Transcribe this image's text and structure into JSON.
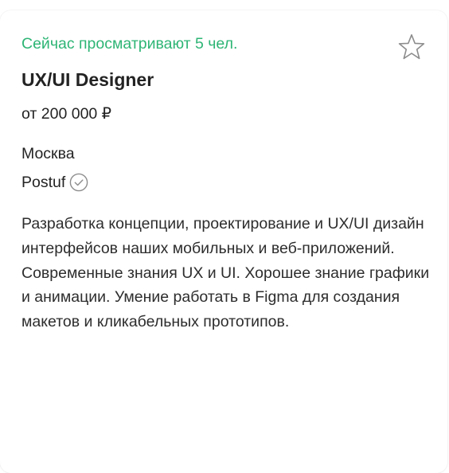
{
  "vacancy": {
    "viewers_text": "Сейчас просматривают 5 чел.",
    "title": "UX/UI Designer",
    "salary": "от 200 000 ₽",
    "city": "Москва",
    "company": "Postuf",
    "description": [
      "Разработка концепции, проектирование и UX/UI дизайн интерфейсов наших мобильных и веб-приложений.",
      "Современные знания UX и UI. Хорошее знание графики и анимации. Умение работать в Figma для создания макетов и кликабельных прототипов."
    ]
  },
  "icons": {
    "favorite": "star-outline-icon",
    "verified": "check-circle-icon"
  },
  "colors": {
    "accent_green": "#2eb575",
    "text_primary": "#232323",
    "icon_gray": "#8c8c8c"
  }
}
